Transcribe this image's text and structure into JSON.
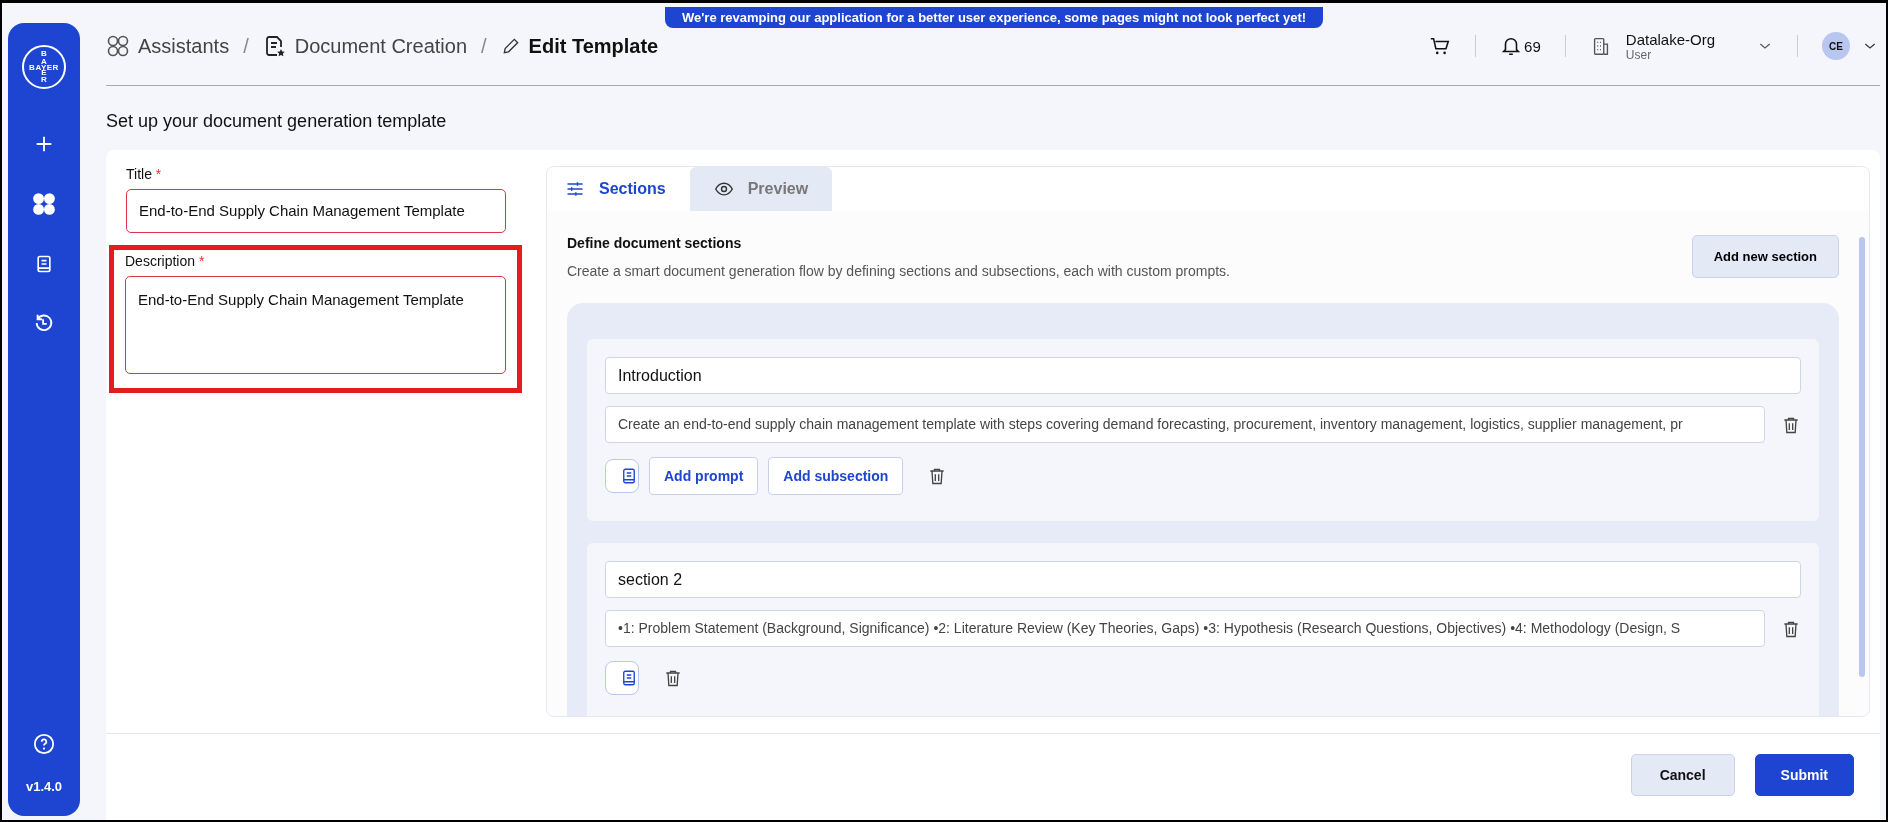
{
  "banner": "We're revamping our application for a better user experience, some pages might not look perfect yet!",
  "sidebar": {
    "logo": {
      "top": "BA",
      "across": "BAYER",
      "bottom": "ER"
    },
    "version": "v1.4.0"
  },
  "breadcrumbs": [
    {
      "label": "Assistants",
      "current": false
    },
    {
      "label": "Document Creation",
      "current": false
    },
    {
      "label": "Edit Template",
      "current": true
    }
  ],
  "separator": "/",
  "header": {
    "notifications": "69",
    "org": "Datalake-Org",
    "role": "User",
    "avatar": "CE"
  },
  "page_title": "Set up your document generation template",
  "form": {
    "fields": [
      {
        "kind": "input",
        "label": "Title",
        "required_mark": "*",
        "value": "End-to-End Supply Chain Management Template",
        "highlighted": false
      },
      {
        "kind": "textarea",
        "label": "Description",
        "required_mark": "*",
        "value": "End-to-End Supply Chain Management Template",
        "highlighted": true
      }
    ]
  },
  "tabs": [
    {
      "label": "Sections",
      "selected": true
    },
    {
      "label": "Preview",
      "selected": false
    }
  ],
  "sections_panel": {
    "heading": "Define document sections",
    "subtitle": "Create a smart document generation flow by defining sections and subsections, each with custom prompts.",
    "add_button": "Add new section"
  },
  "sections": [
    {
      "title": "Introduction",
      "prompt": "Create an end-to-end supply chain management template with steps covering demand forecasting, procurement, inventory management, logistics, supplier management, pr",
      "buttons": [
        "Add prompt",
        "Add subsection"
      ]
    },
    {
      "title": "section 2",
      "prompt": "•1: Problem Statement (Background, Significance) •2: Literature Review (Key Theories, Gaps) •3: Hypothesis (Research Questions, Objectives) •4: Methodology (Design, S"
    }
  ],
  "footer": {
    "buttons": [
      {
        "kind": "secondary",
        "label": "Cancel"
      },
      {
        "kind": "primary",
        "label": "Submit"
      }
    ]
  }
}
